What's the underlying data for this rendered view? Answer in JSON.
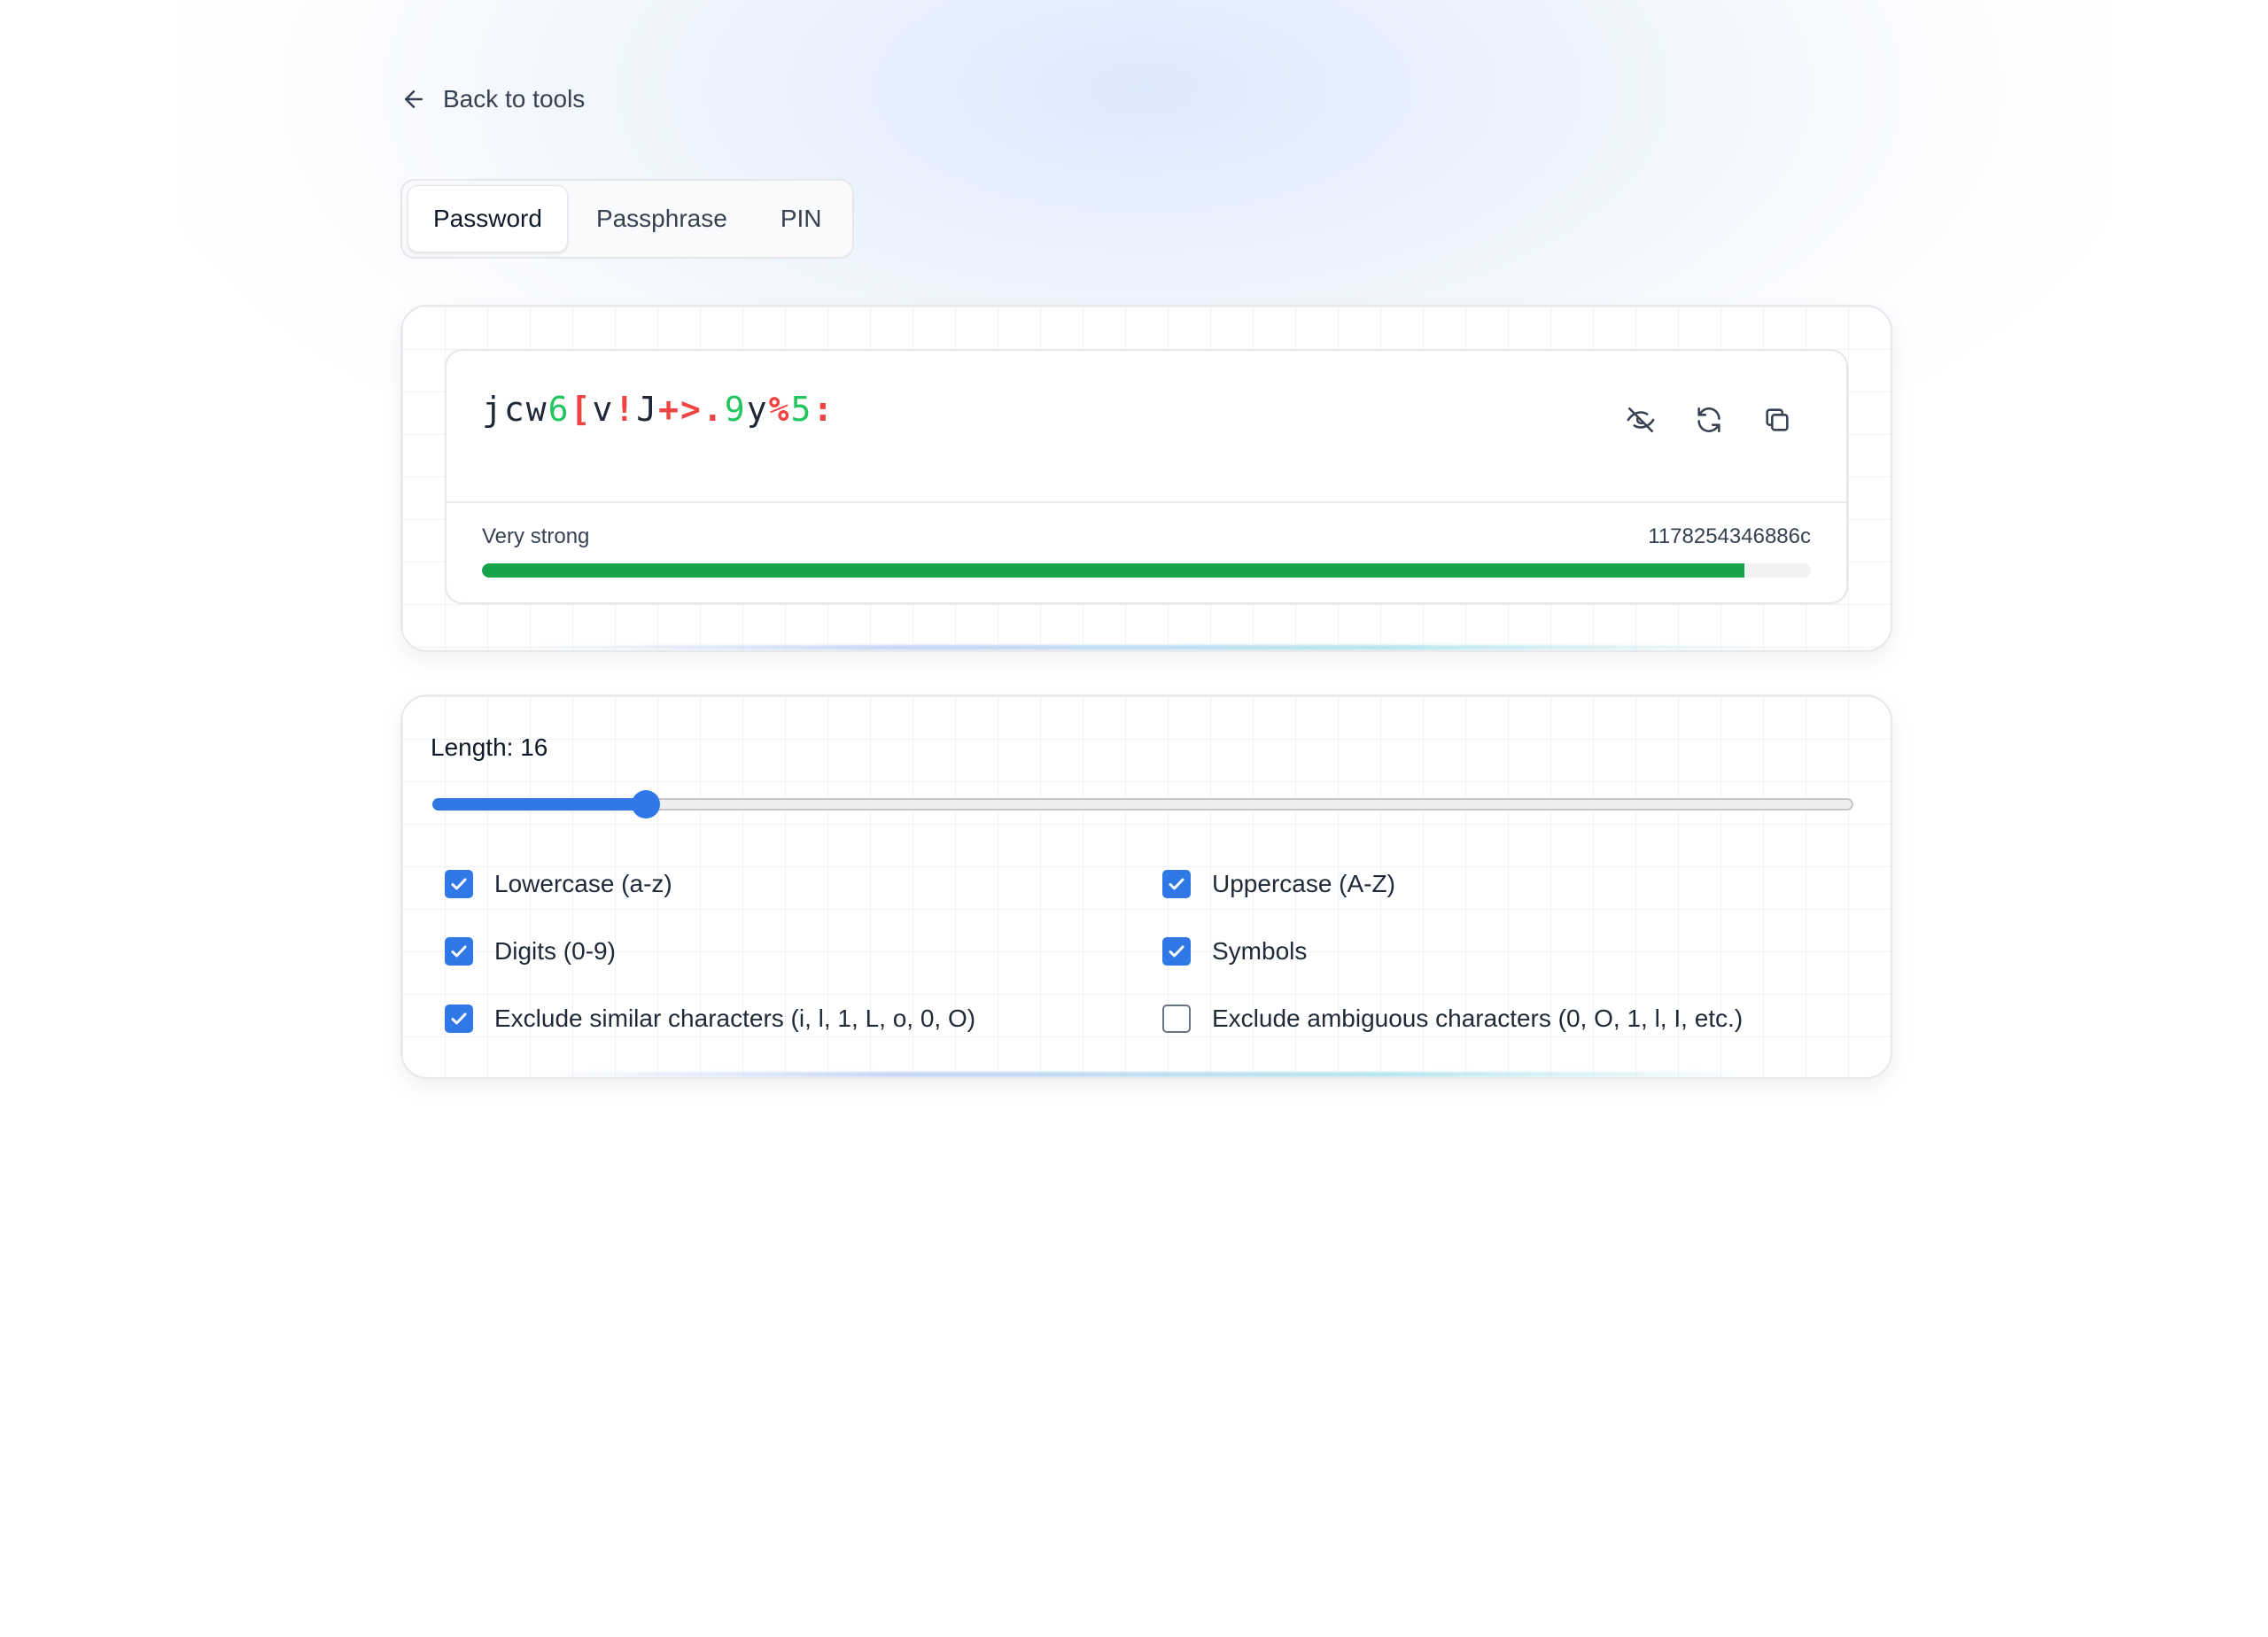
{
  "nav": {
    "back_label": "Back to tools",
    "back_icon": "arrow-left-icon"
  },
  "tabs": [
    {
      "label": "Password",
      "active": true
    },
    {
      "label": "Passphrase",
      "active": false
    },
    {
      "label": "PIN",
      "active": false
    }
  ],
  "generator": {
    "password_chars": [
      {
        "ch": "j",
        "type": "letter"
      },
      {
        "ch": "c",
        "type": "letter"
      },
      {
        "ch": "w",
        "type": "letter"
      },
      {
        "ch": "6",
        "type": "digit"
      },
      {
        "ch": "[",
        "type": "symbol"
      },
      {
        "ch": "v",
        "type": "letter"
      },
      {
        "ch": "!",
        "type": "symbol"
      },
      {
        "ch": "J",
        "type": "letter"
      },
      {
        "ch": "+",
        "type": "symbol"
      },
      {
        "ch": ">",
        "type": "symbol"
      },
      {
        "ch": ".",
        "type": "symbol"
      },
      {
        "ch": "9",
        "type": "digit"
      },
      {
        "ch": "y",
        "type": "letter"
      },
      {
        "ch": "%",
        "type": "symbol"
      },
      {
        "ch": "5",
        "type": "digit"
      },
      {
        "ch": ":",
        "type": "symbol"
      }
    ],
    "actions": {
      "toggle_visibility_icon": "eye-off-icon",
      "regenerate_icon": "refresh-icon",
      "copy_icon": "copy-icon"
    },
    "strength_label": "Very strong",
    "strength_value": "1178254346886c",
    "strength_fraction": 0.95
  },
  "settings": {
    "length_label": "Length: 16",
    "length_value": 16,
    "length_slider_fraction": 0.15,
    "options": [
      {
        "label": "Lowercase (a-z)",
        "checked": true
      },
      {
        "label": "Uppercase (A-Z)",
        "checked": true
      },
      {
        "label": "Digits (0-9)",
        "checked": true
      },
      {
        "label": "Symbols",
        "checked": true
      },
      {
        "label": "Exclude similar characters (i, l, 1, L, o, 0, O)",
        "checked": true
      },
      {
        "label": "Exclude ambiguous characters (0, O, 1, l, I, etc.)",
        "checked": false
      }
    ]
  },
  "colors": {
    "letter": "#1f2937",
    "digit": "#22c55e",
    "symbol": "#ef4444",
    "accent": "#2f78e6",
    "strength": "#16a34a"
  }
}
